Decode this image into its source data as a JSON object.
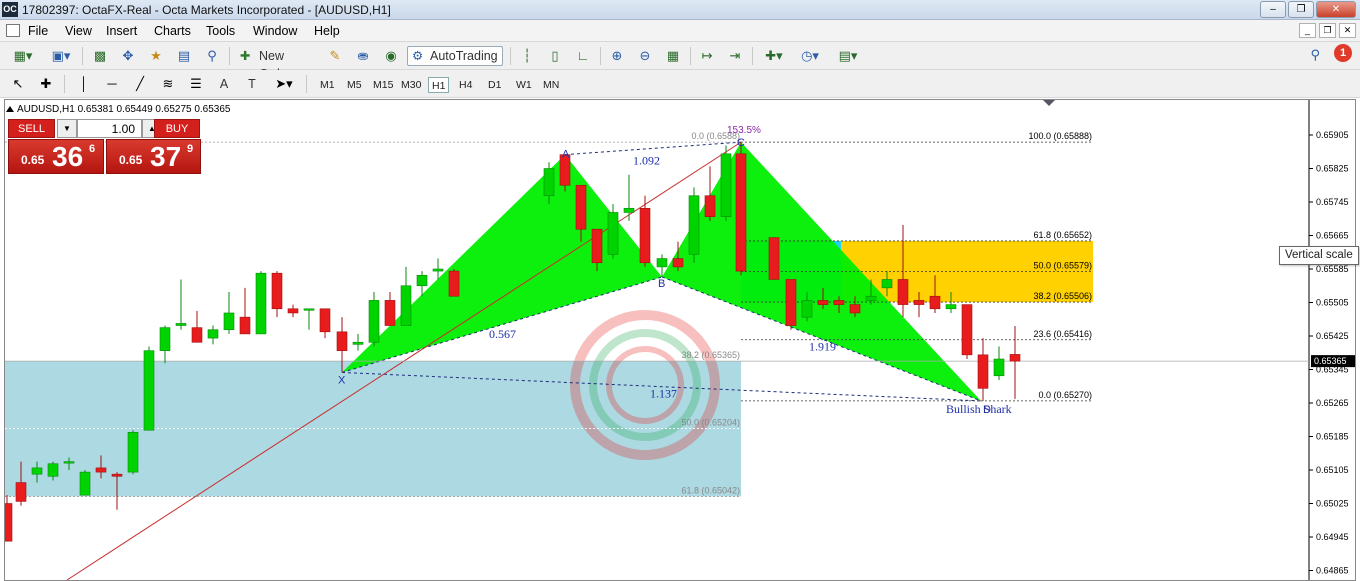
{
  "window": {
    "title": "17802397: OctaFX-Real - Octa Markets Incorporated - [AUDUSD,H1]",
    "app_icon_text": "OC",
    "minimize": "–",
    "restore": "❐",
    "close": "✕"
  },
  "menu": {
    "items": [
      "File",
      "View",
      "Insert",
      "Charts",
      "Tools",
      "Window",
      "Help"
    ],
    "mdi_min": "_",
    "mdi_restore": "❐",
    "mdi_close": "✕"
  },
  "toolbar": {
    "new_order": "New Order",
    "auto_trading": "AutoTrading",
    "notification_count": "1"
  },
  "timeframes": {
    "items": [
      "M1",
      "M5",
      "M15",
      "M30",
      "H1",
      "H4",
      "D1",
      "W1",
      "MN"
    ],
    "active": "H1"
  },
  "drawing_tools": {
    "text_tool": "A",
    "label_tool": "T"
  },
  "chart": {
    "symbol_info": "AUDUSD,H1  0.65381 0.65449 0.65275 0.65365",
    "current_price": "0.65365",
    "tooltip": "Vertical scale",
    "price_labels": [
      "0.65905",
      "0.65825",
      "0.65745",
      "0.65665",
      "0.65585",
      "0.65505",
      "0.65425",
      "0.65345",
      "0.65265",
      "0.65185",
      "0.65105",
      "0.65025",
      "0.64945",
      "0.64865"
    ],
    "fib_right": [
      {
        "label": "100.0 (0.65888)",
        "price": 0.65888
      },
      {
        "label": "61.8 (0.65652)",
        "price": 0.65652
      },
      {
        "label": "50.0 (0.65579)",
        "price": 0.65579
      },
      {
        "label": "38.2 (0.65506)",
        "price": 0.65506
      },
      {
        "label": "23.6 (0.65416)",
        "price": 0.65416
      },
      {
        "label": "0.0 (0.65270)",
        "price": 0.6527
      }
    ],
    "fib_left": [
      {
        "label": "0.0 (0.6588)",
        "price": 0.65888
      },
      {
        "label": "38.2 (0.65365)",
        "price": 0.65365
      },
      {
        "label": "50.0 (0.65204)",
        "price": 0.65204
      },
      {
        "label": "61.8 (0.65042)",
        "price": 0.65042
      }
    ],
    "pattern": {
      "name": "Bullish Shark",
      "points": [
        "X",
        "A",
        "B",
        "C",
        "D"
      ],
      "ratios": {
        "xa_b": "0.567",
        "ab_c": "1.092",
        "bc_d": "1.919",
        "xd": "1.137",
        "extension": "153.5%"
      }
    },
    "colors": {
      "up": "#00d400",
      "down": "#e81c1c",
      "pattern_fill": "#00ee00",
      "fib_zone": "#ffd100",
      "cyan_zone": "#22d3f0",
      "left_zone": "#add9e2"
    }
  },
  "trade_panel": {
    "sell_label": "SELL",
    "buy_label": "BUY",
    "lot": "1.00",
    "lot_down": "▼",
    "lot_up": "▲",
    "sell_small": "0.65",
    "sell_big": "36",
    "sell_sup": "6",
    "buy_small": "0.65",
    "buy_big": "37",
    "buy_sup": "9"
  }
}
